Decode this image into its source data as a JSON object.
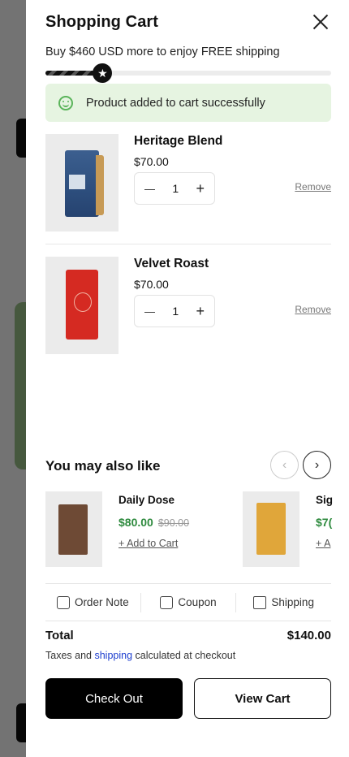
{
  "cart": {
    "title": "Shopping Cart",
    "shipping_message": "Buy $460 USD more to enjoy FREE shipping",
    "shipping_progress": 0.2,
    "success_message": "Product added to cart successfully",
    "items": [
      {
        "name": "Heritage Blend",
        "price": "$70.00",
        "quantity": "1",
        "remove_label": "Remove"
      },
      {
        "name": "Velvet Roast",
        "price": "$70.00",
        "quantity": "1",
        "remove_label": "Remove"
      }
    ],
    "recommendations": {
      "title": "You may also like",
      "products": [
        {
          "name": "Daily Dose",
          "price": "$80.00",
          "old_price": "$90.00",
          "add_label": "+ Add to Cart"
        },
        {
          "name": "Sig",
          "price": "$7(",
          "add_label": "+ A"
        }
      ]
    },
    "actions": [
      "Order Note",
      "Coupon",
      "Shipping"
    ],
    "total_label": "Total",
    "total_value": "$140.00",
    "tax_prefix": "Taxes and ",
    "tax_link": "shipping",
    "tax_suffix": " calculated at checkout",
    "checkout_label": "Check Out",
    "view_cart_label": "View Cart"
  },
  "icons": {
    "close": "close-icon",
    "plus": "plus-icon",
    "minus": "minus-icon",
    "prev": "chevron-left-icon",
    "next": "chevron-right-icon",
    "success": "smile-icon",
    "star": "star-icon",
    "note": "note-icon",
    "coupon": "coupon-icon",
    "shipping": "box-icon"
  },
  "colors": {
    "success_bg": "#e6f4e1",
    "sale_price": "#2e8a3e",
    "link": "#1e3fcf"
  },
  "glyphs": {
    "minus": "—",
    "plus": "+",
    "prev": "‹",
    "next": "›",
    "star": "★"
  }
}
